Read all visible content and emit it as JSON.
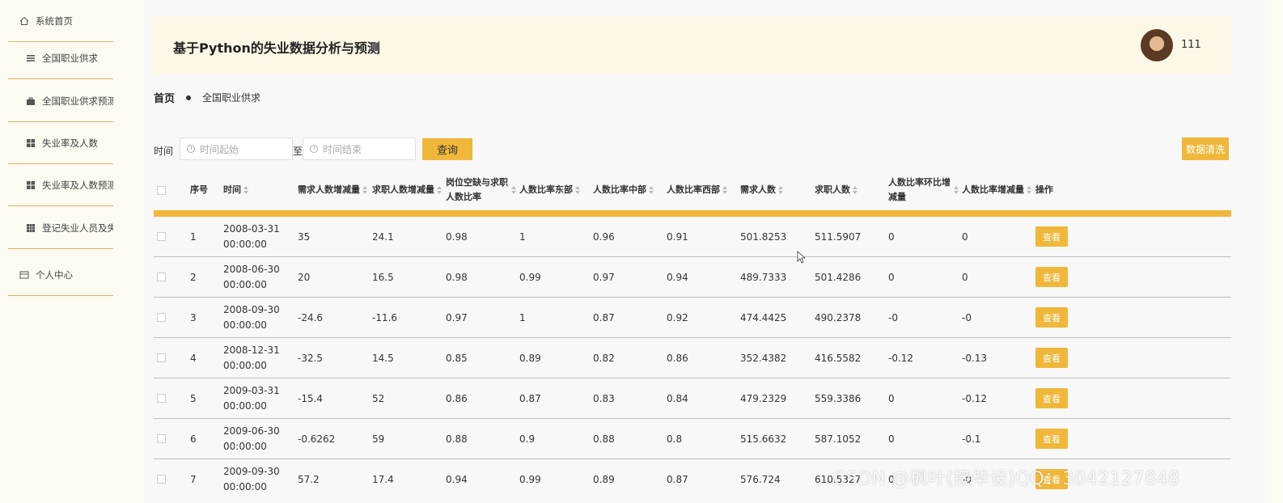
{
  "sidebar": {
    "items": [
      {
        "label": "系统首页",
        "icon": "home-icon"
      },
      {
        "label": "全国职业供求",
        "icon": "list-icon"
      },
      {
        "label": "全国职业供求预测",
        "icon": "briefcase-icon"
      },
      {
        "label": "失业率及人数",
        "icon": "grid-icon"
      },
      {
        "label": "失业率及人数预测",
        "icon": "grid-icon"
      },
      {
        "label": "登记失业人员及失",
        "icon": "grid-icon"
      },
      {
        "label": "个人中心",
        "icon": "card-icon"
      }
    ]
  },
  "header": {
    "title": "基于Python的失业数据分析与预测",
    "username": "111"
  },
  "breadcrumb": {
    "home": "首页",
    "current": "全国职业供求"
  },
  "search": {
    "time_label": "时间",
    "start_placeholder": "时间起始",
    "to_label": "至",
    "end_placeholder": "时间结束",
    "query_label": "查询",
    "clean_label": "数据清洗"
  },
  "table": {
    "headers": {
      "index": "序号",
      "time": "时间",
      "demand_change": "需求人数增减量",
      "seeker_change": "求职人数增减量",
      "ratio": "岗位空缺与求职人数比率",
      "east": "人数比率东部",
      "central": "人数比率中部",
      "west": "人数比率西部",
      "demand": "需求人数",
      "seekers": "求职人数",
      "qoq_change": "人数比率环比增减量",
      "ratio_change": "人数比率增减量",
      "action": "操作"
    },
    "view_label": "查看",
    "rows": [
      {
        "index": "1",
        "time": "2008-03-31 00:00:00",
        "demand_change": "35",
        "seeker_change": "24.1",
        "ratio": "0.98",
        "east": "1",
        "central": "0.96",
        "west": "0.91",
        "demand": "501.8253",
        "seekers": "511.5907",
        "qoq_change": "0",
        "ratio_change": "0"
      },
      {
        "index": "2",
        "time": "2008-06-30 00:00:00",
        "demand_change": "20",
        "seeker_change": "16.5",
        "ratio": "0.98",
        "east": "0.99",
        "central": "0.97",
        "west": "0.94",
        "demand": "489.7333",
        "seekers": "501.4286",
        "qoq_change": "0",
        "ratio_change": "0"
      },
      {
        "index": "3",
        "time": "2008-09-30 00:00:00",
        "demand_change": "-24.6",
        "seeker_change": "-11.6",
        "ratio": "0.97",
        "east": "1",
        "central": "0.87",
        "west": "0.92",
        "demand": "474.4425",
        "seekers": "490.2378",
        "qoq_change": "-0",
        "ratio_change": "-0"
      },
      {
        "index": "4",
        "time": "2008-12-31 00:00:00",
        "demand_change": "-32.5",
        "seeker_change": "14.5",
        "ratio": "0.85",
        "east": "0.89",
        "central": "0.82",
        "west": "0.86",
        "demand": "352.4382",
        "seekers": "416.5582",
        "qoq_change": "-0.12",
        "ratio_change": "-0.13"
      },
      {
        "index": "5",
        "time": "2009-03-31 00:00:00",
        "demand_change": "-15.4",
        "seeker_change": "52",
        "ratio": "0.86",
        "east": "0.87",
        "central": "0.83",
        "west": "0.84",
        "demand": "479.2329",
        "seekers": "559.3386",
        "qoq_change": "0",
        "ratio_change": "-0.12"
      },
      {
        "index": "6",
        "time": "2009-06-30 00:00:00",
        "demand_change": "-0.6262",
        "seeker_change": "59",
        "ratio": "0.88",
        "east": "0.9",
        "central": "0.88",
        "west": "0.8",
        "demand": "515.6632",
        "seekers": "587.1052",
        "qoq_change": "0",
        "ratio_change": "-0.1"
      },
      {
        "index": "7",
        "time": "2009-09-30 00:00:00",
        "demand_change": "57.2",
        "seeker_change": "17.4",
        "ratio": "0.94",
        "east": "0.99",
        "central": "0.89",
        "west": "0.87",
        "demand": "576.724",
        "seekers": "610.5327",
        "qoq_change": "0",
        "ratio_change": "-0"
      }
    ]
  },
  "watermark": "CSDN @枫叶(接毕设)QQ：3042127848",
  "colors": {
    "accent": "#f0b73a",
    "divider": "#d6b46a",
    "header_bg": "#fdf7e7"
  }
}
